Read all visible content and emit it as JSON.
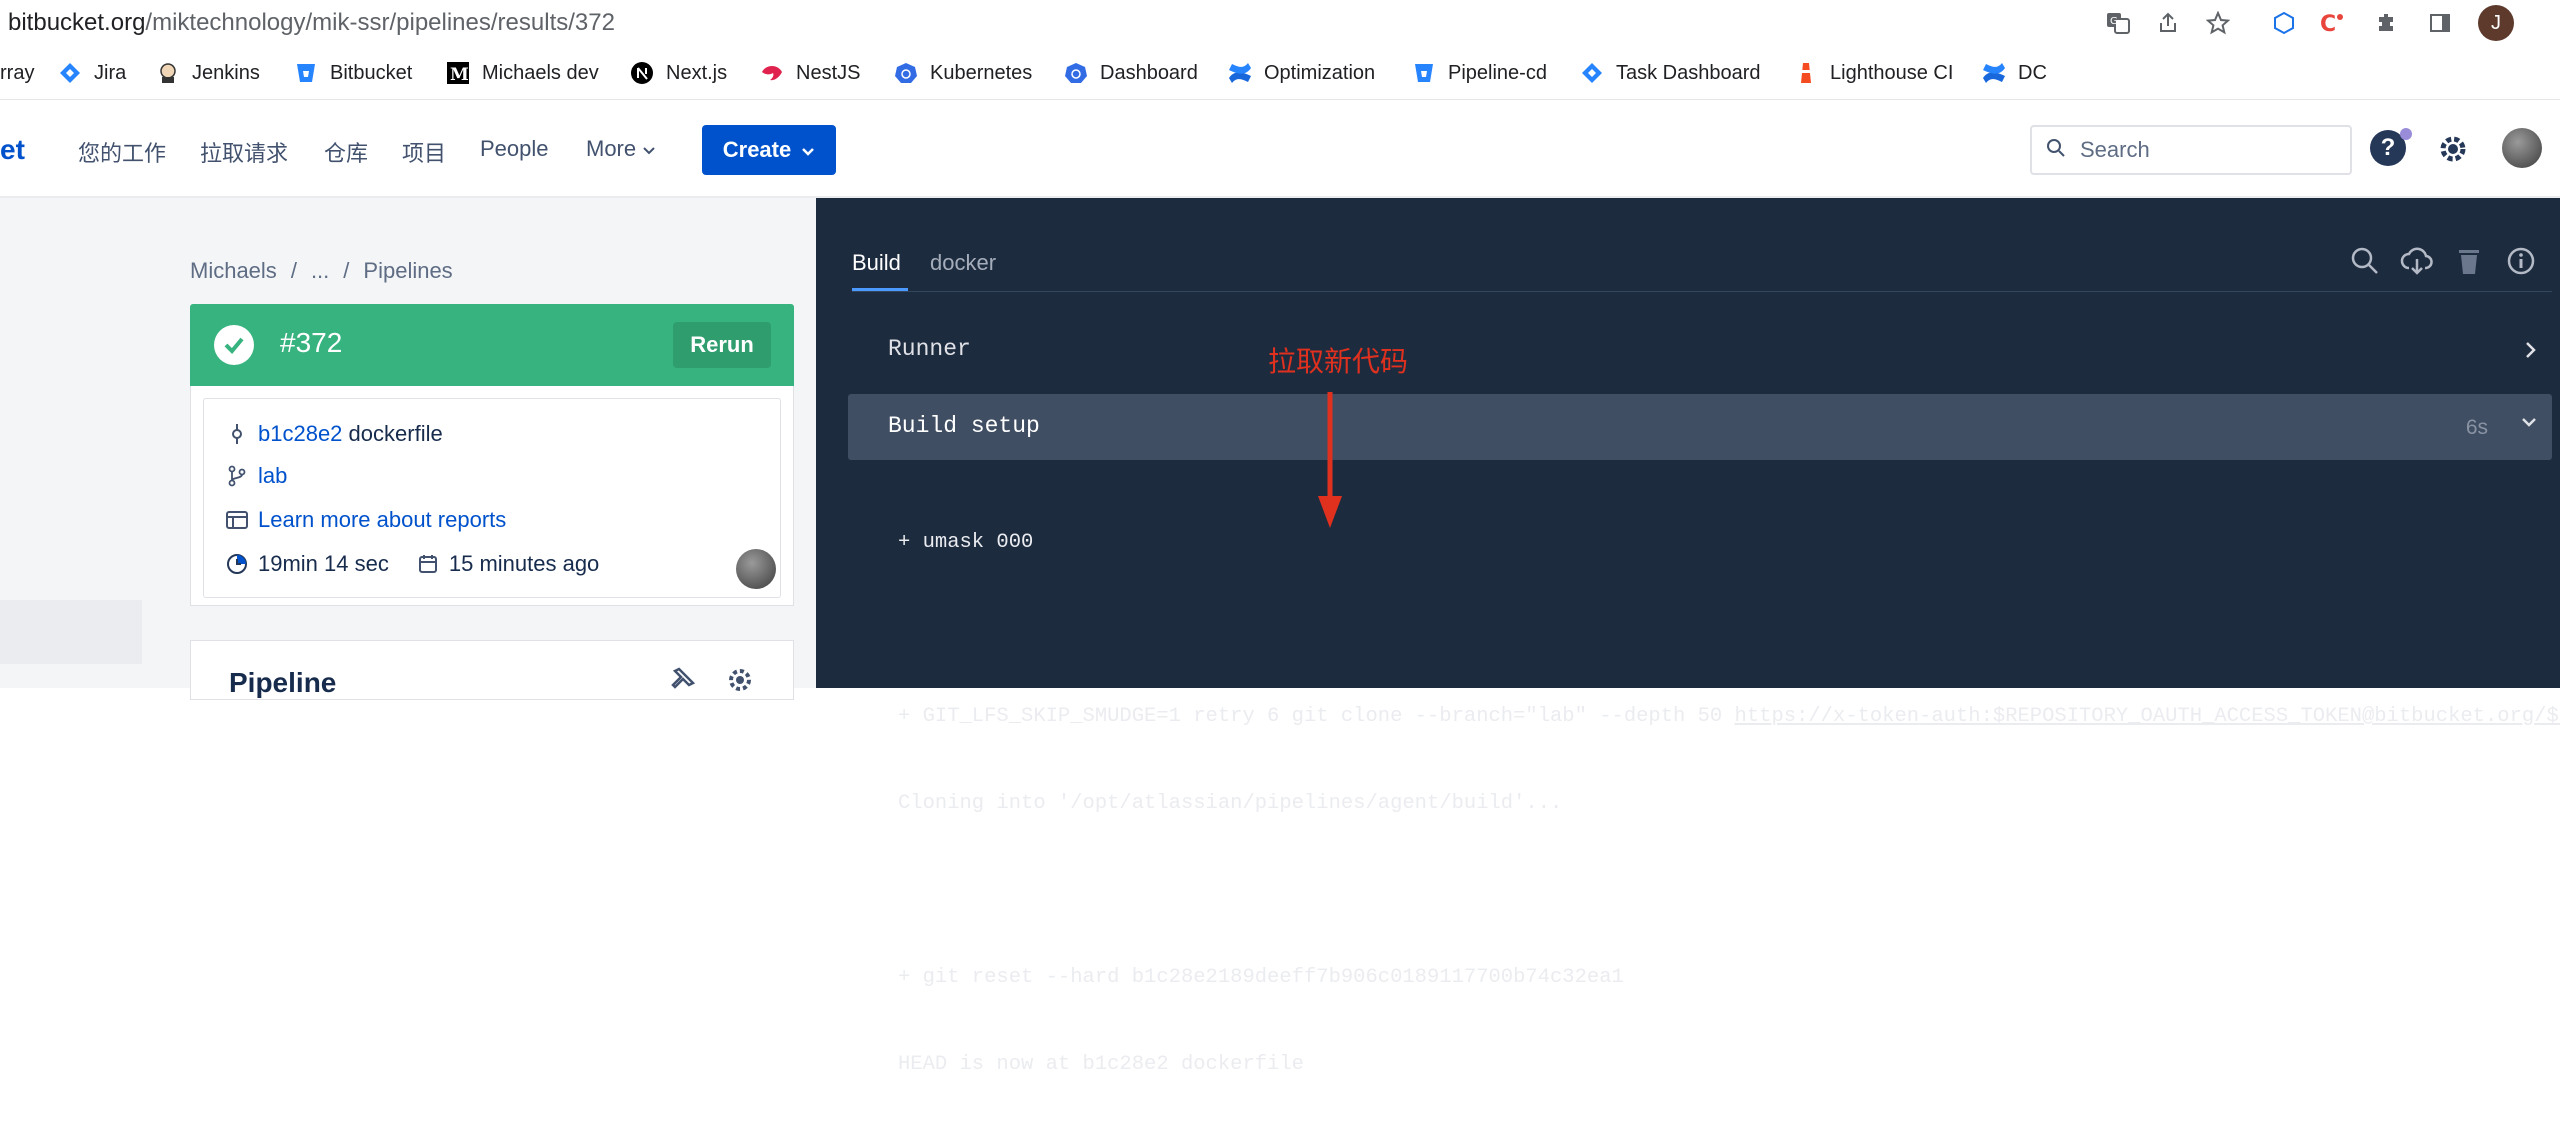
{
  "browser": {
    "url_domain": "bitbucket.org",
    "url_path": "/miktechnology/mik-ssr/pipelines/results/372",
    "profile_initial": "J"
  },
  "bookmarks": [
    {
      "label": "rray"
    },
    {
      "label": "Jira"
    },
    {
      "label": "Jenkins"
    },
    {
      "label": "Bitbucket"
    },
    {
      "label": "Michaels dev"
    },
    {
      "label": "Next.js"
    },
    {
      "label": "NestJS"
    },
    {
      "label": "Kubernetes"
    },
    {
      "label": "Dashboard"
    },
    {
      "label": "Optimization"
    },
    {
      "label": "Pipeline-cd"
    },
    {
      "label": "Task Dashboard"
    },
    {
      "label": "Lighthouse CI"
    },
    {
      "label": "DC"
    }
  ],
  "nav": {
    "brand": "et",
    "items": [
      "您的工作",
      "拉取请求",
      "仓库",
      "项目",
      "People",
      "More"
    ],
    "create_label": "Create",
    "search_placeholder": "Search",
    "help_label": "?"
  },
  "breadcrumb": {
    "project": "Michaels",
    "ellipsis": "...",
    "sep": "/",
    "page": "Pipelines"
  },
  "pipeline": {
    "number": "#372",
    "rerun_label": "Rerun",
    "commit_hash": "b1c28e2",
    "commit_message": "dockerfile",
    "branch": "lab",
    "reports_link": "Learn more about reports",
    "duration": "19min 14 sec",
    "time_ago": "15 minutes ago",
    "section_title": "Pipeline"
  },
  "log": {
    "tabs": [
      "Build",
      "docker"
    ],
    "runner_label": "Runner",
    "setup_label": "Build setup",
    "setup_duration": "6s",
    "lines": [
      "+ umask 000",
      "",
      "+ GIT_LFS_SKIP_SMUDGE=1 retry 6 git clone --branch=\"lab\" --depth 50 ",
      "Cloning into '/opt/atlassian/pipelines/agent/build'...",
      "",
      "+ git reset --hard b1c28e2189deeff7b906c0189117700b74c32ea1",
      "HEAD is now at b1c28e2 dockerfile"
    ],
    "clone_url": "https://x-token-auth:$REPOSITORY_OAUTH_ACCESS_TOKEN@bitbucket.org/$BITBUCKET"
  },
  "annotation": {
    "text": "拉取新代码",
    "color": "#e0301e"
  },
  "colors": {
    "success": "#36b37e",
    "primary": "#0052cc",
    "log_bg": "#1d2b3f"
  }
}
